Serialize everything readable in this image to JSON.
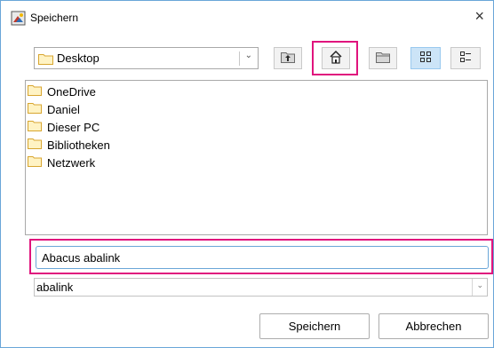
{
  "window": {
    "title": "Speichern",
    "close_glyph": "×"
  },
  "toolbar": {
    "location": "Desktop",
    "location_icon": "folder-icon",
    "buttons": [
      {
        "name": "up-one-level",
        "icon": "up-folder-icon"
      },
      {
        "name": "home",
        "icon": "home-icon"
      },
      {
        "name": "new-folder",
        "icon": "new-folder-icon"
      },
      {
        "name": "list-view",
        "icon": "list-view-icon",
        "selected": true
      },
      {
        "name": "details-view",
        "icon": "details-view-icon",
        "selected": false
      }
    ]
  },
  "files": [
    {
      "label": "OneDrive"
    },
    {
      "label": "Daniel"
    },
    {
      "label": "Dieser PC"
    },
    {
      "label": "Bibliotheken"
    },
    {
      "label": "Netzwerk"
    }
  ],
  "filename": {
    "value": "Abacus abalink"
  },
  "filetype": {
    "value": "abalink"
  },
  "actions": {
    "save_label": "Speichern",
    "cancel_label": "Abbrechen"
  },
  "colors": {
    "highlight": "#e0147d",
    "selected_button": "#cce4f7",
    "folder": "#f4c542",
    "window_border": "#6aa6d8"
  }
}
